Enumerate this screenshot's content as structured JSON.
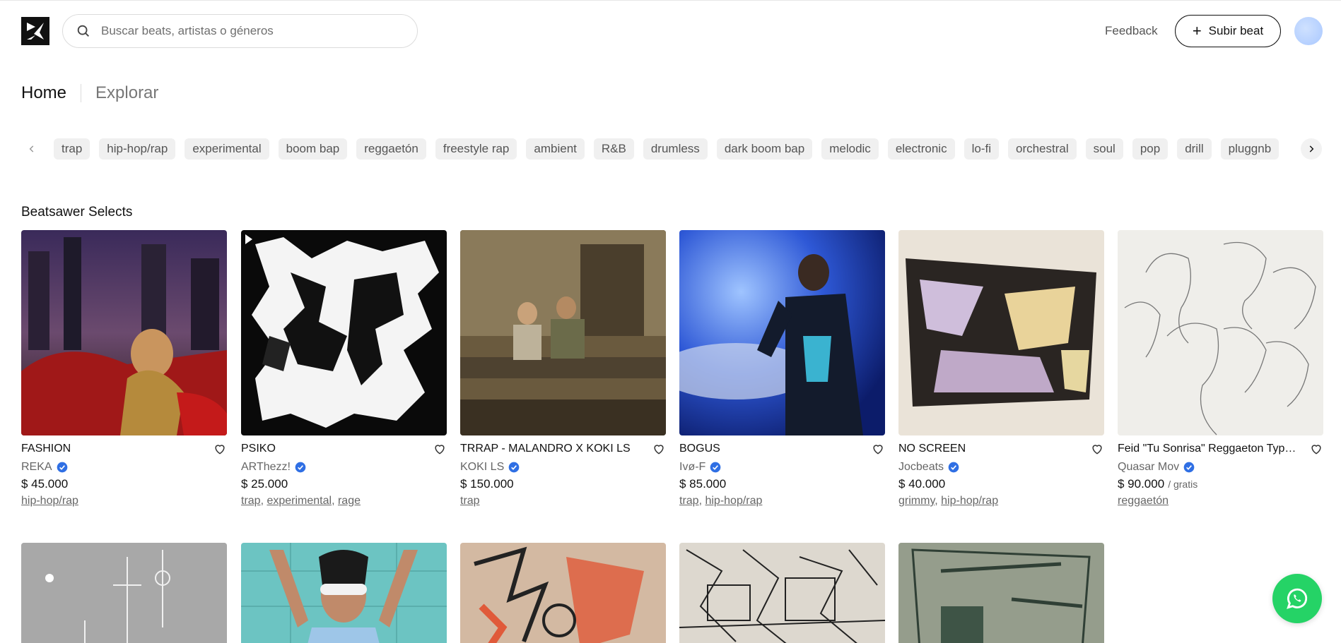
{
  "header": {
    "search_placeholder": "Buscar beats, artistas o géneros",
    "feedback_label": "Feedback",
    "upload_label": "Subir beat"
  },
  "nav": {
    "home": "Home",
    "explore": "Explorar"
  },
  "genres": [
    "trap",
    "hip-hop/rap",
    "experimental",
    "boom bap",
    "reggaetón",
    "freestyle rap",
    "ambient",
    "R&B",
    "drumless",
    "dark boom bap",
    "melodic",
    "electronic",
    "lo-fi",
    "orchestral",
    "soul",
    "pop",
    "drill",
    "pluggnb"
  ],
  "section": {
    "title": "Beatsawer Selects"
  },
  "beats": [
    {
      "title": "FASHION",
      "artist": "REKA",
      "price": "$ 45.000",
      "free": "",
      "tags": [
        "hip-hop/rap"
      ]
    },
    {
      "title": "PSIKO",
      "artist": "ARThezz!",
      "price": "$ 25.000",
      "free": "",
      "tags": [
        "trap",
        "experimental",
        "rage"
      ]
    },
    {
      "title": "TRRAP - MALANDRO X KOKI LS",
      "artist": "KOKI LS",
      "price": "$ 150.000",
      "free": "",
      "tags": [
        "trap"
      ]
    },
    {
      "title": "BOGUS",
      "artist": "Ivø-F",
      "price": "$ 85.000",
      "free": "",
      "tags": [
        "trap",
        "hip-hop/rap"
      ]
    },
    {
      "title": "NO SCREEN",
      "artist": "Jocbeats",
      "price": "$ 40.000",
      "free": "",
      "tags": [
        "grimmy",
        "hip-hop/rap"
      ]
    },
    {
      "title": "Feid \"Tu Sonrisa\" Reggaeton Type Beat",
      "artist": "Quasar Mov",
      "price": "$ 90.000",
      "free": "/ gratis",
      "tags": [
        "reggaetón"
      ]
    }
  ],
  "colors": {
    "accent": "#111111",
    "verified": "#2f6fe4",
    "whatsapp": "#25d366"
  }
}
